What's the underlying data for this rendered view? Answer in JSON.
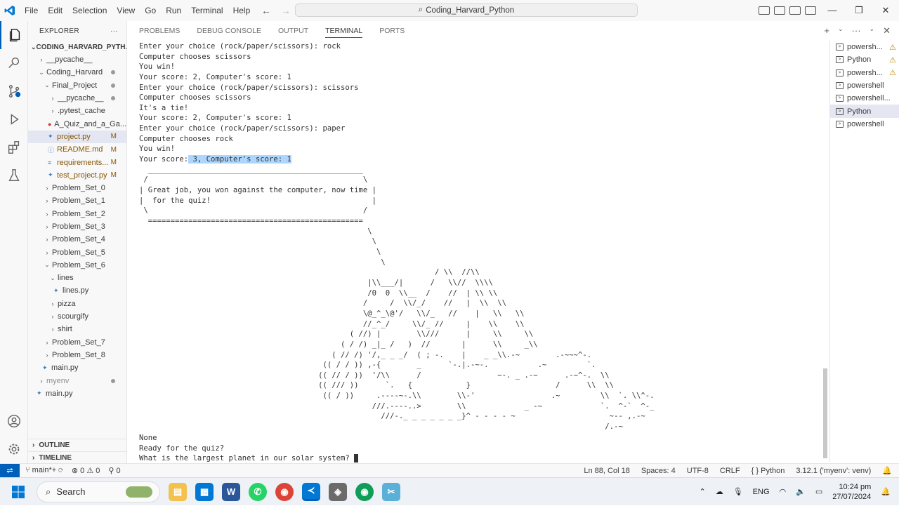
{
  "titlebar": {
    "menu": [
      "File",
      "Edit",
      "Selection",
      "View",
      "Go",
      "Run",
      "Terminal",
      "Help"
    ],
    "search": "Coding_Harvard_Python"
  },
  "explorer": {
    "header": "EXPLORER",
    "root": "CODING_HARVARD_PYTH...",
    "items": [
      {
        "label": "__pycache__",
        "indent": 1,
        "type": "folder",
        "open": false,
        "badge": ""
      },
      {
        "label": "Coding_Harvard",
        "indent": 1,
        "type": "folder",
        "open": true,
        "badge": "dot"
      },
      {
        "label": "Final_Project",
        "indent": 2,
        "type": "folder",
        "open": true,
        "badge": "dot"
      },
      {
        "label": "__pycache__",
        "indent": 3,
        "type": "folder",
        "open": false,
        "badge": "dot"
      },
      {
        "label": ".pytest_cache",
        "indent": 3,
        "type": "folder",
        "open": false,
        "badge": ""
      },
      {
        "label": "A_Quiz_and_a_Ga...",
        "indent": 3,
        "type": "file-red",
        "badge": ""
      },
      {
        "label": "project.py",
        "indent": 3,
        "type": "py",
        "badge": "M",
        "selected": true
      },
      {
        "label": "README.md",
        "indent": 3,
        "type": "md",
        "badge": "M"
      },
      {
        "label": "requirements...",
        "indent": 3,
        "type": "txt",
        "badge": "M"
      },
      {
        "label": "test_project.py",
        "indent": 3,
        "type": "py",
        "badge": "M"
      },
      {
        "label": "Problem_Set_0",
        "indent": 2,
        "type": "folder",
        "open": false,
        "badge": ""
      },
      {
        "label": "Problem_Set_1",
        "indent": 2,
        "type": "folder",
        "open": false,
        "badge": ""
      },
      {
        "label": "Problem_Set_2",
        "indent": 2,
        "type": "folder",
        "open": false,
        "badge": ""
      },
      {
        "label": "Problem_Set_3",
        "indent": 2,
        "type": "folder",
        "open": false,
        "badge": ""
      },
      {
        "label": "Problem_Set_4",
        "indent": 2,
        "type": "folder",
        "open": false,
        "badge": ""
      },
      {
        "label": "Problem_Set_5",
        "indent": 2,
        "type": "folder",
        "open": false,
        "badge": ""
      },
      {
        "label": "Problem_Set_6",
        "indent": 2,
        "type": "folder",
        "open": true,
        "badge": ""
      },
      {
        "label": "lines",
        "indent": 3,
        "type": "folder",
        "open": true,
        "badge": ""
      },
      {
        "label": "lines.py",
        "indent": 4,
        "type": "py",
        "badge": ""
      },
      {
        "label": "pizza",
        "indent": 3,
        "type": "folder",
        "open": false,
        "badge": ""
      },
      {
        "label": "scourgify",
        "indent": 3,
        "type": "folder",
        "open": false,
        "badge": ""
      },
      {
        "label": "shirt",
        "indent": 3,
        "type": "folder",
        "open": false,
        "badge": ""
      },
      {
        "label": "Problem_Set_7",
        "indent": 2,
        "type": "folder",
        "open": false,
        "badge": ""
      },
      {
        "label": "Problem_Set_8",
        "indent": 2,
        "type": "folder",
        "open": false,
        "badge": ""
      },
      {
        "label": "main.py",
        "indent": 2,
        "type": "py",
        "badge": ""
      },
      {
        "label": "myenv",
        "indent": 1,
        "type": "folder",
        "open": false,
        "badge": "dot"
      },
      {
        "label": "main.py",
        "indent": 1,
        "type": "py",
        "badge": ""
      }
    ],
    "outline": "OUTLINE",
    "timeline": "TIMELINE"
  },
  "panel": {
    "tabs": [
      "PROBLEMS",
      "DEBUG CONSOLE",
      "OUTPUT",
      "TERMINAL",
      "PORTS"
    ],
    "active_tab": "TERMINAL"
  },
  "terminal": {
    "lines_top": [
      "Enter your choice (rock/paper/scissors): rock",
      "Computer chooses scissors",
      "You win!",
      "Your score: 2, Computer's score: 1",
      "Enter your choice (rock/paper/scissors): scissors",
      "Computer chooses scissors",
      "It's a tie!",
      "Your score: 2, Computer's score: 1",
      "Enter your choice (rock/paper/scissors): paper",
      "Computer chooses rock",
      "You win!"
    ],
    "score_prefix": "Your score:",
    "score_selected": " 3, Computer's score: 1",
    "ascii_art": "  ________________________________________________\n /                                                \\\n| Great job, you won against the computer, now time |\n|  for the quiz!                                    |\n \\                                                /\n  ================================================\n                                                   \\\n                                                    \\\n                                                     \\\n                                                      \\\n                                                                  / \\\\  //\\\\\n                                                   |\\\\___/|      /   \\\\//  \\\\\\\\\n                                                   /0  0  \\\\__  /    //  | \\\\ \\\\\n                                                  /     /  \\\\/_/    //   |  \\\\  \\\\\n                                                  \\@_^_\\@'/   \\\\/_   //    |   \\\\   \\\\\n                                                  //_^_/     \\\\/_ //     |    \\\\    \\\\\n                                               ( //) |        \\\\///      |     \\\\     \\\\\n                                             ( / /) _|_ /   )  //       |      \\\\     _\\\\\n                                           ( // /) '/,_ _ _/  ( ; -.    |    _ _\\\\.-~        .-~~~^-.\n                                         (( / / )) ,-{        _      `-.|.-~-.           .~         `.\n                                        (( // / ))  '/\\\\      /                 ~-. _ .-~      .-~^-.  \\\\\n                                        (( /// ))      `.   {            }                   /      \\\\  \\\\\n                                         (( / ))     .----~-.\\\\        \\\\-'                 .~         \\\\  `. \\\\^-.\n                                                    ///.----..>        \\\\             _ -~             `.  ^-`  ^-_\n                                                      ///-._ _ _ _ _ _ _}^ - - - - ~                     ~-- ,.-~\n                                                                                                        /.-~",
    "lines_bottom": [
      "None",
      "Ready for the quiz?",
      "What is the largest planet in our solar system? "
    ]
  },
  "terminal_list": [
    {
      "label": "powersh...",
      "warn": true
    },
    {
      "label": "Python",
      "warn": true
    },
    {
      "label": "powersh...",
      "warn": true
    },
    {
      "label": "powershell",
      "warn": false
    },
    {
      "label": "powershell...",
      "warn": false
    },
    {
      "label": "Python",
      "warn": false,
      "active": true
    },
    {
      "label": "powershell",
      "warn": false
    }
  ],
  "statusbar": {
    "branch": "main*+",
    "errors": "0",
    "warnings": "0",
    "ports": "0",
    "position": "Ln 88, Col 18",
    "spaces": "Spaces: 4",
    "encoding": "UTF-8",
    "eol": "CRLF",
    "language": "Python",
    "interpreter": "3.12.1 ('myenv': venv)"
  },
  "taskbar": {
    "search": "Search",
    "lang": "ENG",
    "time": "10:24 pm",
    "date": "27/07/2024"
  },
  "colors": {
    "accent": "#005fb8",
    "selection": "#add6ff",
    "warning": "#bf8803"
  }
}
